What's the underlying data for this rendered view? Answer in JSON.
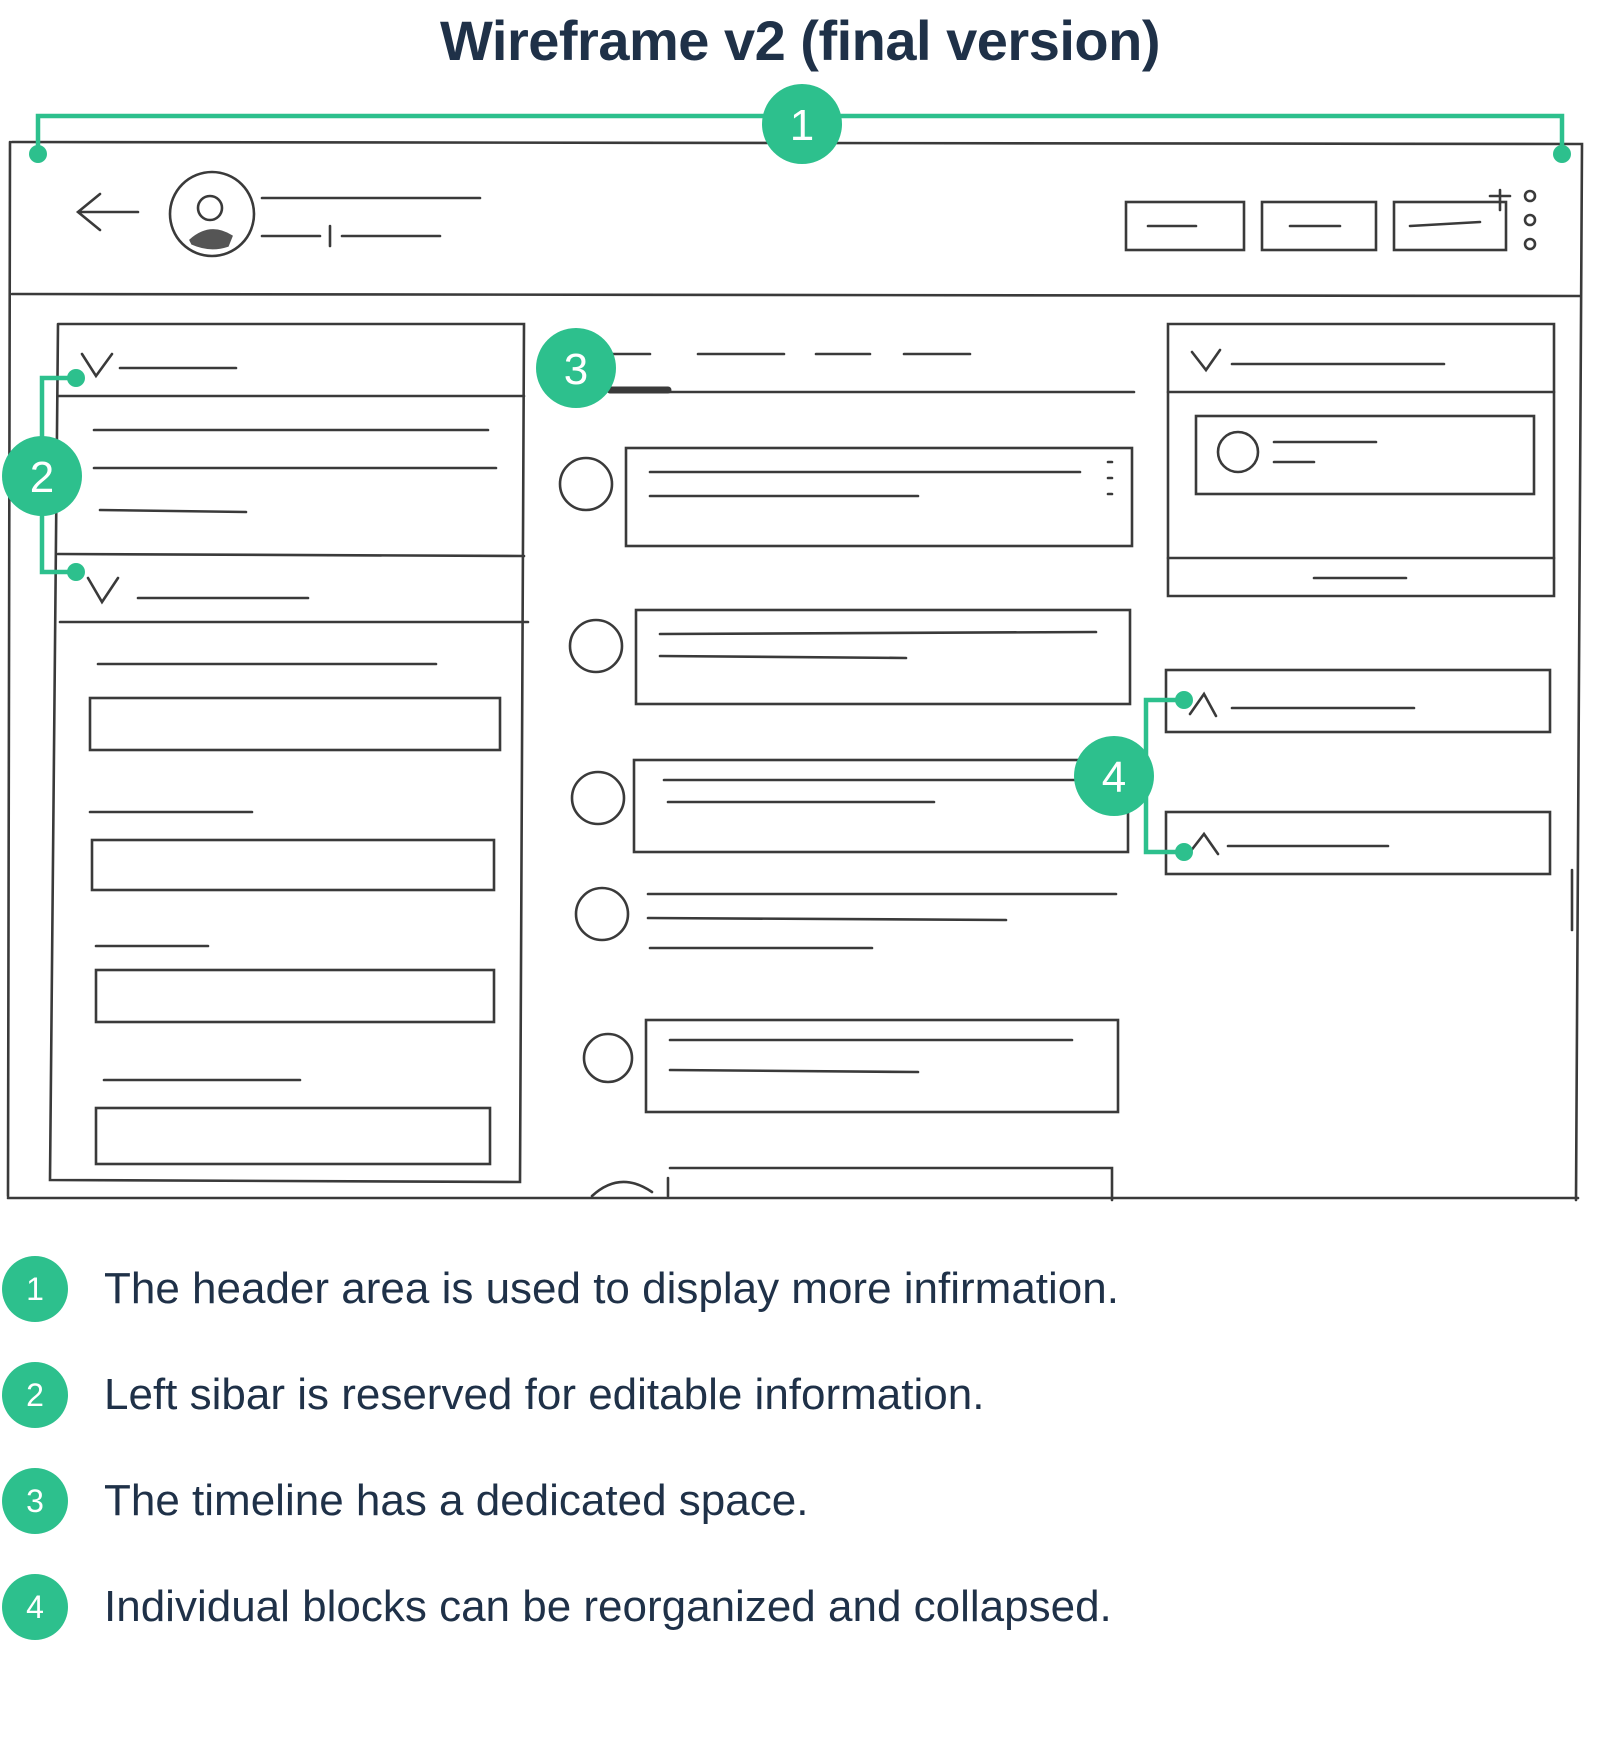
{
  "title": "Wireframe v2 (final version)",
  "colors": {
    "accent": "#2dc08d",
    "text": "#1f3148",
    "sketch": "#3a3a3a"
  },
  "annotations": [
    {
      "number": "1"
    },
    {
      "number": "2"
    },
    {
      "number": "3"
    },
    {
      "number": "4"
    }
  ],
  "legend": [
    {
      "number": "1",
      "text": "The header area is used to display more infirmation."
    },
    {
      "number": "2",
      "text": "Left sibar is reserved for editable information."
    },
    {
      "number": "3",
      "text": "The timeline has a dedicated space."
    },
    {
      "number": "4",
      "text": "Individual blocks can be reorganized and collapsed."
    }
  ]
}
